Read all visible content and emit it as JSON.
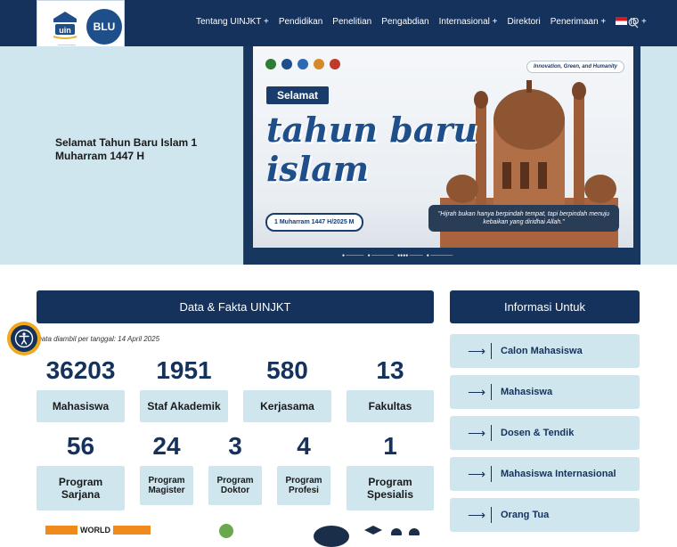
{
  "header": {
    "logo_uin_name": "uin",
    "logo_blu_name": "BLU",
    "nav": [
      {
        "label": "Tentang UINJKT +"
      },
      {
        "label": "Pendidikan"
      },
      {
        "label": "Penelitian"
      },
      {
        "label": "Pengabdian"
      },
      {
        "label": "Internasional +"
      },
      {
        "label": "Direktori"
      },
      {
        "label": "Penerimaan +"
      }
    ],
    "language": "ID +",
    "search_icon": "search-icon"
  },
  "hero": {
    "title": "Selamat Tahun Baru Islam 1 Muharram 1447 H",
    "banner": {
      "selamat": "Selamat",
      "headline_line1": "tahun baru",
      "headline_line2": "islam",
      "date_pill": "1 Muharram 1447 H/2025 M",
      "tagline": "Innovation, Green, and Humanity",
      "quote": "\"Hijrah bukan hanya berpindah tempat, tapi berpindah menuju kebaikan yang diridhai Allah.\""
    }
  },
  "data_fakta": {
    "heading": "Data & Fakta UINJKT",
    "date_note": "Data diambil per tanggal: 14 April 2025",
    "stats_row1": [
      {
        "value": "36203",
        "label": "Mahasiswa"
      },
      {
        "value": "1951",
        "label": "Staf Akademik"
      },
      {
        "value": "580",
        "label": "Kerjasama"
      },
      {
        "value": "13",
        "label": "Fakultas"
      }
    ],
    "stats_row2": [
      {
        "value": "56",
        "label": "Program Sarjana"
      },
      {
        "value": "24",
        "label": "Program Magister"
      },
      {
        "value": "3",
        "label": "Program Doktor"
      },
      {
        "value": "4",
        "label": "Program Profesi"
      },
      {
        "value": "1",
        "label": "Program Spesialis"
      }
    ]
  },
  "informasi": {
    "heading": "Informasi Untuk",
    "items": [
      {
        "label": "Calon Mahasiswa"
      },
      {
        "label": "Mahasiswa"
      },
      {
        "label": "Dosen & Tendik"
      },
      {
        "label": "Mahasiswa Internasional"
      },
      {
        "label": "Orang Tua"
      }
    ]
  },
  "accessibility": {
    "icon": "accessibility-icon"
  },
  "bottom": {
    "world_label": "WORLD"
  },
  "colors": {
    "navy": "#14325c",
    "light": "#cfe6ef",
    "accent": "#f2a81d"
  }
}
